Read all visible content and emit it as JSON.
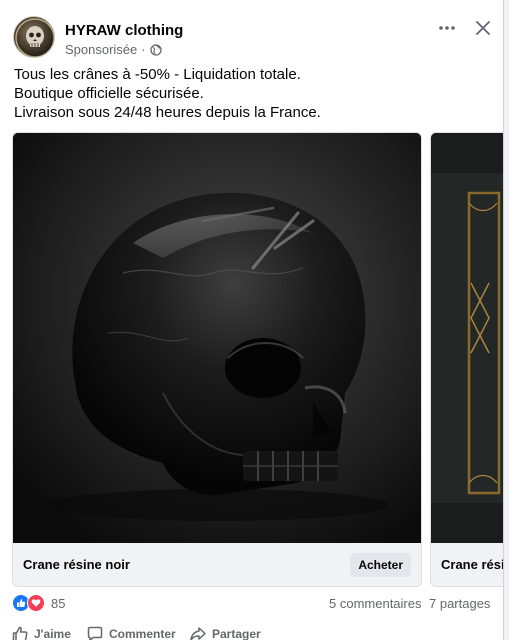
{
  "post": {
    "page_name": "HYRAW clothing",
    "sponsored_label": "Sponsorisée",
    "separator": "·",
    "audience_icon": "globe-icon",
    "text_lines": [
      "Tous les crânes à -50% - Liquidation totale.",
      "Boutique officielle sécurisée.",
      "Livraison sous 24/48 heures depuis la France."
    ]
  },
  "carousel": {
    "items": [
      {
        "title": "Crane résine noir",
        "cta": "Acheter",
        "image": "black-resin-skull-photo"
      },
      {
        "title": "Crane résine",
        "image": "dark-product-with-gold-pattern"
      }
    ]
  },
  "stats": {
    "reaction_icons": [
      "like-icon",
      "love-icon"
    ],
    "reaction_count": "85",
    "comments": "5 commentaires",
    "shares": "7 partages"
  },
  "actions": {
    "like": "J'aime",
    "comment": "Commenter",
    "share": "Partager"
  },
  "colors": {
    "brand_blue": "#1877f2",
    "love_red": "#f33e58",
    "secondary_text": "#65676b"
  }
}
